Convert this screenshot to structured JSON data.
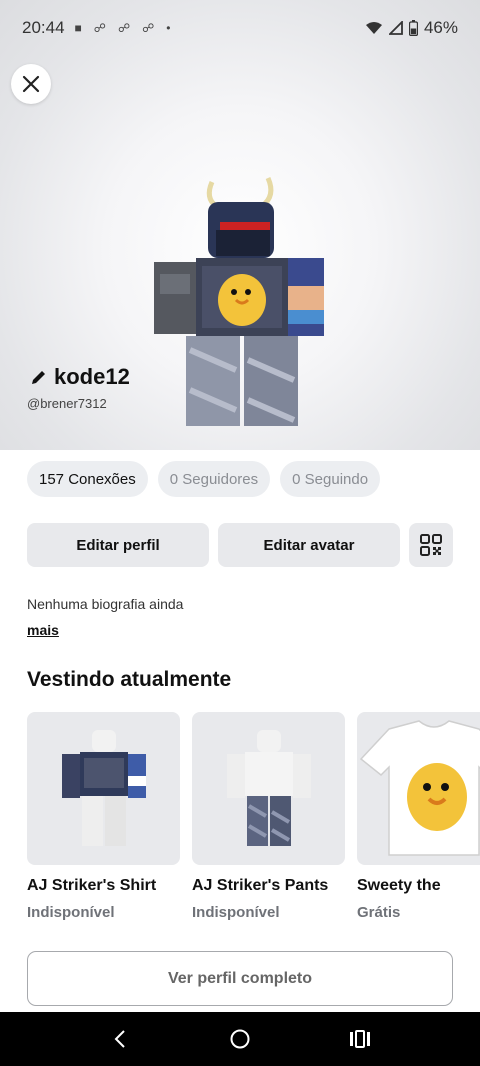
{
  "status_bar": {
    "time": "20:44",
    "battery": "46%",
    "notification_icons": [
      "app-notification-icon",
      "discord-icon",
      "discord-icon",
      "discord-icon",
      "dot-icon"
    ]
  },
  "profile": {
    "display_name": "kode12",
    "username": "@brener7312",
    "stats": {
      "connections": "157 Conexões",
      "followers": "0 Seguidores",
      "following": "0 Seguindo"
    },
    "buttons": {
      "edit_profile": "Editar perfil",
      "edit_avatar": "Editar avatar"
    },
    "bio": "Nenhuma biografia ainda",
    "more_label": "mais"
  },
  "wearing": {
    "title": "Vestindo atualmente",
    "items": [
      {
        "name": "AJ Striker's Shirt",
        "status": "Indisponível"
      },
      {
        "name": "AJ Striker's Pants",
        "status": "Indisponível"
      },
      {
        "name": "Sweety the",
        "status": "Grátis"
      }
    ]
  },
  "full_profile_label": "Ver perfil completo",
  "colors": {
    "chip_bg": "#eceef1",
    "button_bg": "#e8e9ec",
    "muted_text": "#8a8d93",
    "nav_bg": "#000000"
  }
}
